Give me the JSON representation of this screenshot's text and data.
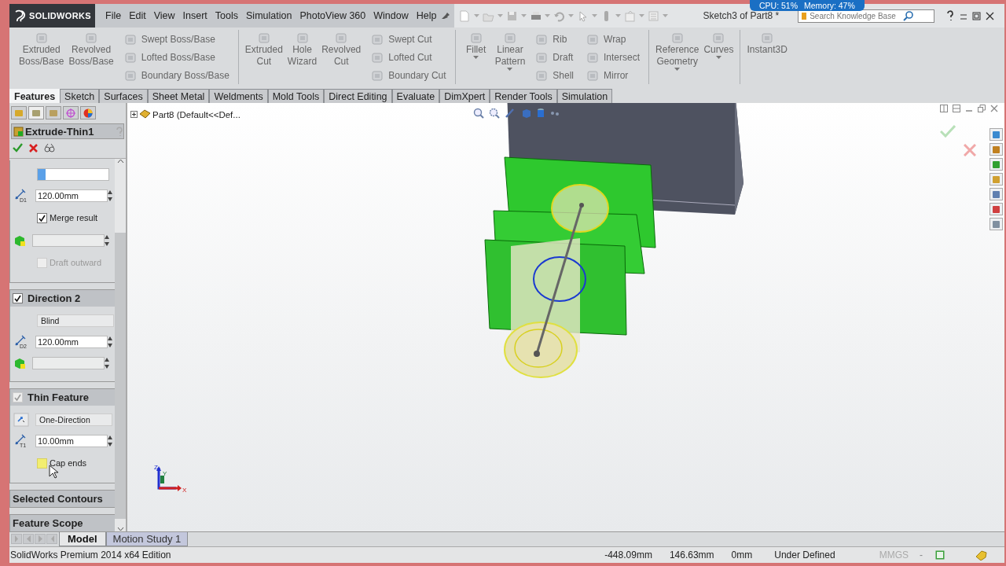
{
  "app": {
    "logo": "SOLIDWORKS"
  },
  "menu": [
    "File",
    "Edit",
    "View",
    "Insert",
    "Tools",
    "Simulation",
    "PhotoView 360",
    "Window",
    "Help"
  ],
  "document_title": "Sketch3 of Part8 *",
  "performance": {
    "cpu": "CPU: 51%",
    "memory": "Memory: 47%"
  },
  "search": {
    "placeholder": "Search Knowledge Base"
  },
  "ribbon": {
    "groups": [
      {
        "items": [
          {
            "kind": "large",
            "label": "Extruded\nBoss/Base",
            "menu": false
          },
          {
            "kind": "large",
            "label": "Revolved\nBoss/Base",
            "menu": false
          },
          {
            "kind": "stack",
            "items": [
              "Swept Boss/Base",
              "Lofted Boss/Base",
              "Boundary Boss/Base"
            ]
          }
        ]
      },
      {
        "items": [
          {
            "kind": "large",
            "label": "Extruded\nCut",
            "menu": false
          },
          {
            "kind": "large",
            "label": "Hole\nWizard",
            "menu": false
          },
          {
            "kind": "large",
            "label": "Revolved\nCut",
            "menu": false
          },
          {
            "kind": "stack",
            "items": [
              "Swept Cut",
              "Lofted Cut",
              "Boundary Cut"
            ]
          }
        ]
      },
      {
        "items": [
          {
            "kind": "large",
            "label": "Fillet",
            "menu": true
          },
          {
            "kind": "large",
            "label": "Linear\nPattern",
            "menu": true
          },
          {
            "kind": "stack",
            "items": [
              "Rib",
              "Draft",
              "Shell"
            ]
          },
          {
            "kind": "stack",
            "items": [
              "Wrap",
              "Intersect",
              "Mirror"
            ]
          }
        ]
      },
      {
        "items": [
          {
            "kind": "large",
            "label": "Reference\nGeometry",
            "menu": true
          },
          {
            "kind": "large",
            "label": "Curves",
            "menu": true
          }
        ]
      },
      {
        "items": [
          {
            "kind": "large",
            "label": "Instant3D",
            "menu": false
          }
        ]
      }
    ]
  },
  "command_tabs": [
    {
      "label": "Features",
      "selected": true
    },
    {
      "label": "Sketch",
      "selected": false
    },
    {
      "label": "Surfaces",
      "selected": false
    },
    {
      "label": "Sheet Metal",
      "selected": false
    },
    {
      "label": "Weldments",
      "selected": false
    },
    {
      "label": "Mold Tools",
      "selected": false
    },
    {
      "label": "Direct Editing",
      "selected": false
    },
    {
      "label": "Evaluate",
      "selected": false
    },
    {
      "label": "DimXpert",
      "selected": false
    },
    {
      "label": "Render Tools",
      "selected": false
    },
    {
      "label": "Simulation",
      "selected": false
    }
  ],
  "property_manager": {
    "tabs": [
      {
        "selected": false
      },
      {
        "selected": true
      },
      {
        "selected": false
      },
      {
        "selected": false
      },
      {
        "selected": false
      }
    ],
    "title": "Extrude-Thin1",
    "sections": [
      {
        "rows": [
          {
            "kind": "selection"
          },
          {
            "kind": "spin",
            "icon_label": "D1",
            "value": "120.00mm"
          },
          {
            "kind": "checkbox",
            "label": "Merge result",
            "checked": true,
            "disabled": false,
            "highlighted": false
          },
          {
            "kind": "face"
          },
          {
            "kind": "checkbox",
            "label": "Draft outward",
            "checked": false,
            "disabled": true,
            "highlighted": false
          }
        ]
      },
      {
        "title": "Direction 2",
        "checked": true,
        "check_disabled": false,
        "rows": [
          {
            "kind": "dropdown",
            "value": "Blind",
            "icon": false
          },
          {
            "kind": "spin",
            "icon_label": "D2",
            "value": "120.00mm"
          },
          {
            "kind": "face"
          }
        ]
      },
      {
        "title": "Thin Feature",
        "checked": true,
        "check_disabled": true,
        "rows": [
          {
            "kind": "dropdown",
            "value": "One-Direction",
            "icon": true
          },
          {
            "kind": "spin",
            "icon_label": "T1",
            "value": "10.00mm"
          },
          {
            "kind": "checkbox",
            "label": "Cap ends",
            "checked": false,
            "disabled": false,
            "highlighted": true
          }
        ]
      },
      {
        "title": "Selected Contours"
      },
      {
        "title": "Feature Scope"
      }
    ]
  },
  "feature_tree": {
    "root": "Part8  (Default<<Def..."
  },
  "triad": {
    "x": "X",
    "y": "Y",
    "z": "Z"
  },
  "bottom_tabs": [
    {
      "label": "Model",
      "selected": true
    },
    {
      "label": "Motion Study 1",
      "selected": false
    }
  ],
  "status_bar": {
    "edition": "SolidWorks Premium 2014 x64 Edition",
    "x": "-448.09mm",
    "y": "146.63mm",
    "z": "0mm",
    "state": "Under Defined",
    "units": "MMGS",
    "units_menu": "-"
  }
}
